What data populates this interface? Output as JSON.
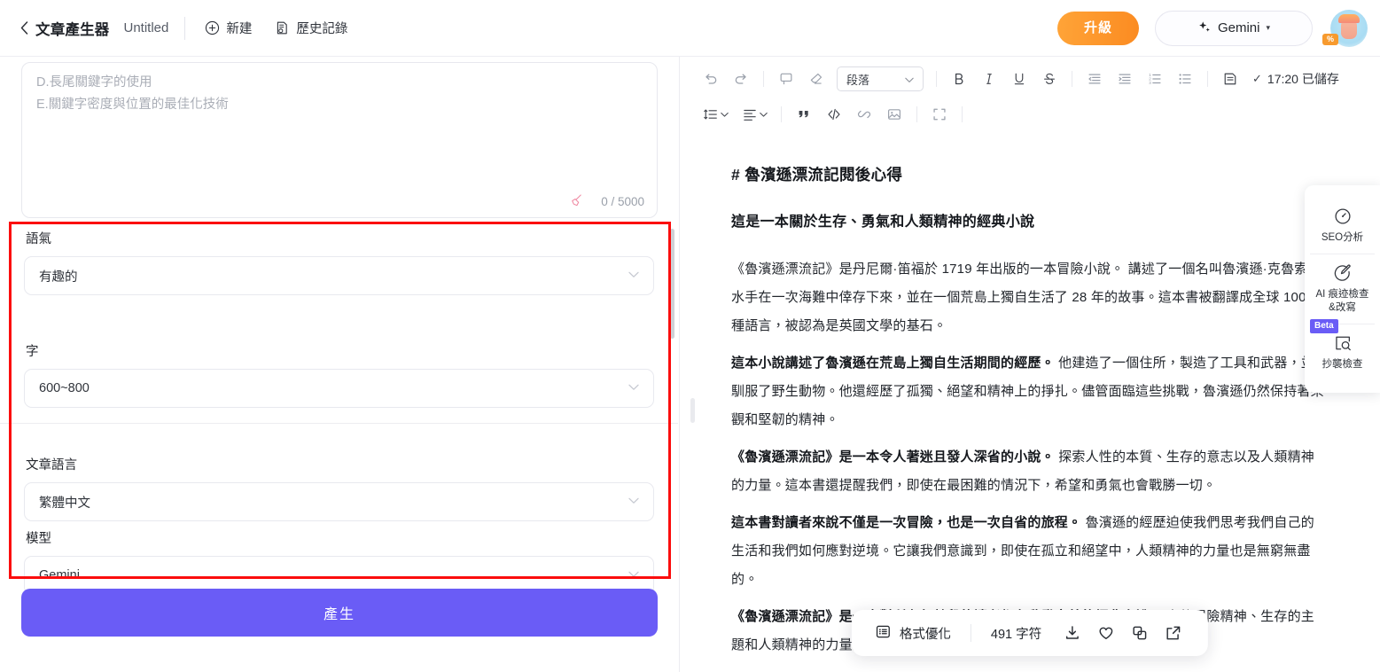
{
  "header": {
    "back_icon": "chevron-left-icon",
    "app_title": "文章產生器",
    "doc_title": "Untitled",
    "new_button": {
      "label": "新建",
      "icon": "plus-circle-icon"
    },
    "history_button": {
      "label": "歷史記錄",
      "icon": "history-document-icon"
    },
    "upgrade_button": "升級",
    "model_pill": {
      "label": "Gemini",
      "icon": "sparkle-icon",
      "caret": "▾"
    },
    "avatar": {
      "name": "user-avatar",
      "badge": "%"
    }
  },
  "left_panel": {
    "prompt": {
      "lines": [
        "D.長尾關鍵字的使用",
        "E.關鍵字密度與位置的最佳化技術"
      ],
      "clear_icon": "broom-icon",
      "counter": "0 / 5000"
    },
    "fields": [
      {
        "label": "語氣",
        "value": "有趣的",
        "name": "tone-select"
      },
      {
        "label": "字",
        "value": "600~800",
        "name": "word-count-select"
      },
      {
        "label": "文章語言",
        "value": "繁體中文",
        "name": "language-select"
      },
      {
        "label": "模型",
        "value": "Gemini",
        "name": "model-select"
      }
    ],
    "generate_button": "產生",
    "highlight_color": "#fb0d0d"
  },
  "editor_toolbar": {
    "row1": [
      {
        "icon": "undo-icon",
        "name": "undo-button"
      },
      {
        "icon": "redo-icon",
        "name": "redo-button"
      },
      {
        "icon": "comment-icon",
        "name": "comment-button"
      },
      {
        "icon": "eraser-icon",
        "name": "clear-format-button"
      }
    ],
    "paragraph_select": {
      "value": "段落",
      "caret": "▾"
    },
    "row1b": [
      {
        "icon": "bold-icon",
        "label": "B",
        "name": "bold-button"
      },
      {
        "icon": "italic-icon",
        "label": "I",
        "name": "italic-button"
      },
      {
        "icon": "underline-icon",
        "label": "U",
        "name": "underline-button"
      },
      {
        "icon": "strikethrough-icon",
        "label": "S",
        "name": "strikethrough-button"
      },
      {
        "icon": "indent-decrease-icon",
        "name": "outdent-button"
      },
      {
        "icon": "indent-increase-icon",
        "name": "indent-button"
      },
      {
        "icon": "ordered-list-icon",
        "name": "ordered-list-button"
      },
      {
        "icon": "bullet-list-icon",
        "name": "bullet-list-button"
      },
      {
        "icon": "save-file-icon",
        "name": "save-button"
      }
    ],
    "save_status": {
      "check": "✓",
      "text": "17:20 已儲存"
    },
    "row2": [
      {
        "icon": "line-height-icon",
        "name": "line-height-button"
      },
      {
        "icon": "text-align-icon",
        "name": "align-button"
      },
      {
        "icon": "quote-icon",
        "name": "blockquote-button"
      },
      {
        "icon": "code-icon",
        "name": "code-button"
      },
      {
        "icon": "link-icon",
        "name": "link-button"
      },
      {
        "icon": "image-icon",
        "name": "image-button"
      },
      {
        "icon": "fullscreen-icon",
        "name": "fullscreen-button"
      }
    ]
  },
  "document": {
    "heading": "# 魯濱遜漂流記閱後心得",
    "subheading": "這是一本關於生存、勇氣和人類精神的經典小說",
    "paragraphs": [
      {
        "bold": "",
        "text": "《魯濱遜漂流記》是丹尼爾·笛福於 1719 年出版的一本冒險小說。 講述了一個名叫魯濱遜·克魯索的水手在一次海難中倖存下來，並在一個荒島上獨自生活了 28 年的故事。這本書被翻譯成全球 100 多種語言，被認為是英國文學的基石。"
      },
      {
        "bold": "這本小說講述了魯濱遜在荒島上獨自生活期間的經歷。",
        "text": " 他建造了一個住所，製造了工具和武器，並馴服了野生動物。他還經歷了孤獨、絕望和精神上的掙扎。儘管面臨這些挑戰，魯濱遜仍然保持著樂觀和堅韌的精神。"
      },
      {
        "bold": "《魯濱遜漂流記》是一本令人著迷且發人深省的小說。",
        "text": " 探索人性的本質、生存的意志以及人類精神的力量。這本書還提醒我們，即使在最困難的情況下，希望和勇氣也會戰勝一切。"
      },
      {
        "bold": "這本書對讀者來說不僅是一次冒險，也是一次自省的旅程。",
        "text": " 魯濱遜的經歷迫使我們思考我們自己的生活和我們如何應對逆境。它讓我們意識到，即使在孤立和絕望中，人類精神的力量也是無窮無盡的。"
      },
      {
        "bold": "《魯濱遜漂流記》是一本對所有年齡段的讀者都有啟發意義的經典小說。",
        "text": " 它的冒險精神、生存的主題和人類精神的力量將繼續激勵和鼓舞讀者幾代人。它是文學中上必讀的一書。"
      }
    ]
  },
  "seo_panel": {
    "items": [
      {
        "icon": "gauge-icon",
        "label": "SEO分析",
        "name": "seo-analysis-button",
        "badge": ""
      },
      {
        "icon": "ai-detect-pen-icon",
        "label": "AI 痕迹檢查\n&改寫",
        "name": "ai-detect-button",
        "badge": ""
      },
      {
        "icon": "plagiarism-search-icon",
        "label": "抄襲檢查",
        "name": "plagiarism-check-button",
        "badge": "Beta"
      }
    ]
  },
  "float_bar": {
    "format_button": {
      "label": "格式優化",
      "icon": "format-list-icon"
    },
    "char_count": "491 字符",
    "actions": [
      {
        "icon": "download-icon",
        "name": "download-button"
      },
      {
        "icon": "heart-icon",
        "name": "favorite-button"
      },
      {
        "icon": "copy-icon",
        "name": "copy-button"
      },
      {
        "icon": "external-link-icon",
        "name": "share-button"
      }
    ]
  }
}
